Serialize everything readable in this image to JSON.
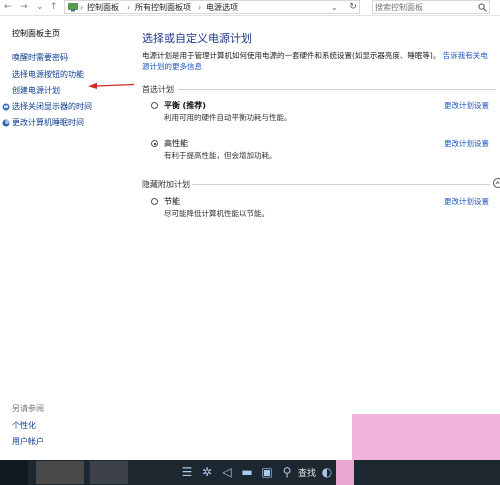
{
  "window": {
    "nav_back": "←",
    "nav_forward": "→",
    "nav_recent": "⌄",
    "nav_up": "↑",
    "breadcrumbs": [
      "控制面板",
      "所有控制面板项",
      "电源选项"
    ],
    "breadcrumb_sep": "›",
    "dropdown_glyph": "⌄",
    "refresh_glyph": "↻",
    "search_placeholder": "搜索控制面板"
  },
  "sidebar": {
    "items": [
      {
        "label": "控制面板主页",
        "icon": null
      },
      {
        "label": "唤醒时需要密码",
        "icon": null
      },
      {
        "label": "选择电源按钮的功能",
        "icon": null
      },
      {
        "label": "创建电源计划",
        "icon": null
      },
      {
        "label": "选择关闭显示器的时间",
        "icon": "display-icon"
      },
      {
        "label": "更改计算机睡眠时间",
        "icon": "moon-icon"
      }
    ],
    "see_also": {
      "title": "另请参阅",
      "items": [
        "个性化",
        "用户帐户"
      ]
    }
  },
  "main": {
    "title": "选择或自定义电源计划",
    "description": "电源计划是用于管理计算机如何使用电源的一套硬件和系统设置(如显示器亮度、睡眠等)。",
    "description_link": "告诉我有关电源计划的更多信息",
    "preferred_group": "首选计划",
    "hidden_group": "隐藏附加计划",
    "plans": [
      {
        "name": "平衡",
        "suffix": "(推荐)",
        "desc": "利用可用的硬件自动平衡功耗与性能。",
        "selected": false,
        "change": "更改计划设置"
      },
      {
        "name": "高性能",
        "suffix": "",
        "desc": "有利于提高性能，但会增加功耗。",
        "selected": true,
        "change": "更改计划设置"
      },
      {
        "name": "节能",
        "suffix": "",
        "desc": "尽可能降低计算机性能以节能。",
        "selected": false,
        "change": "更改计划设置"
      }
    ]
  },
  "taskbar": {
    "search_text": "查找"
  },
  "colors": {
    "accent_link": "#1a56c4",
    "annotation_arrow": "#d42a2a",
    "taskbar": "#1c2730",
    "overlay_pink": "#f0b3dc"
  }
}
